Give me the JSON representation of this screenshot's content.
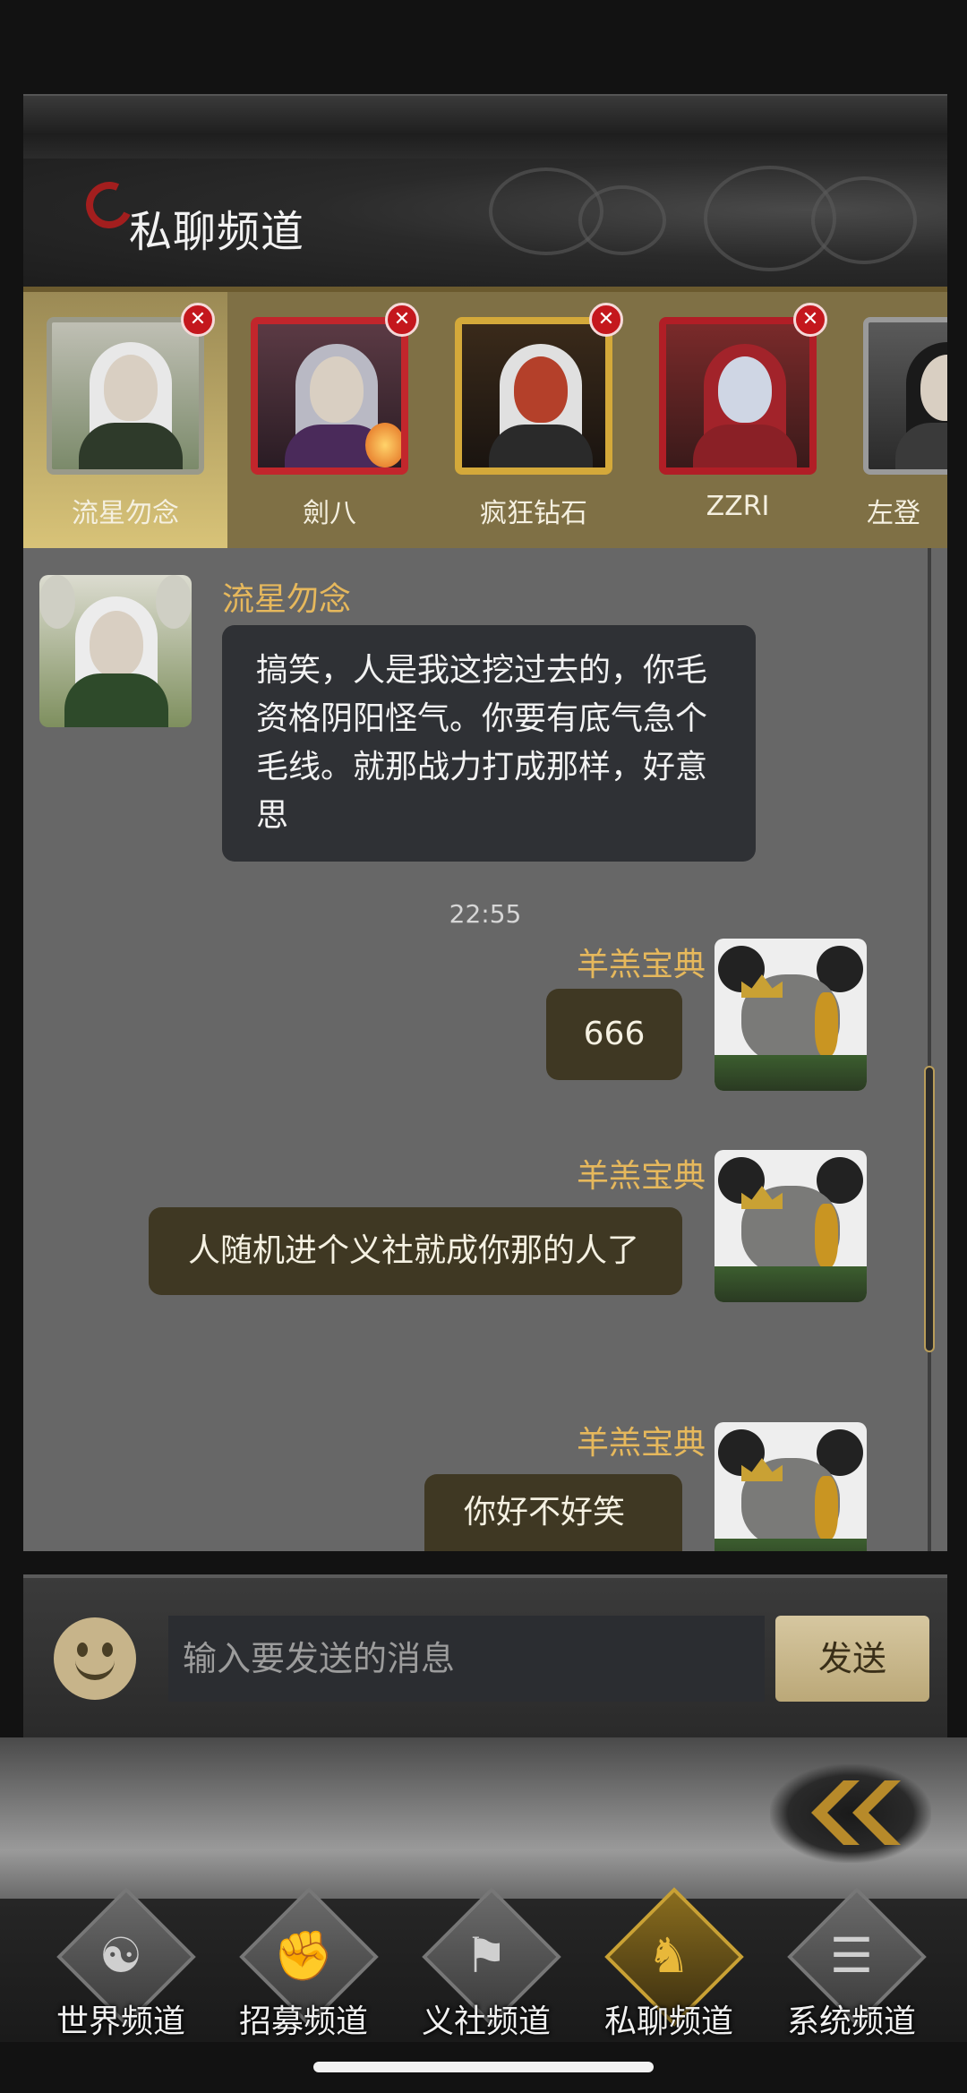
{
  "header": {
    "title": "私聊频道"
  },
  "contacts": [
    {
      "name": "流星勿念",
      "active": true,
      "frame": "#9a9a8a"
    },
    {
      "name": "劍八",
      "active": false,
      "frame": "#c2262c"
    },
    {
      "name": "疯狂钻石",
      "active": false,
      "frame": "#d4a93a"
    },
    {
      "name": "ZZRI",
      "active": false,
      "frame": "#b11e26"
    },
    {
      "name": "左登",
      "active": false,
      "frame": "#9a9a9a"
    }
  ],
  "chat": {
    "messages": [
      {
        "sender": "流星勿念",
        "text": "搞笑，人是我这挖过去的，你毛资格阴阳怪气。你要有底气急个毛线。就那战力打成那样，好意思",
        "direction": "incoming"
      },
      {
        "timestamp": "22:55"
      },
      {
        "sender": "羊羔宝典",
        "text": "666",
        "direction": "outgoing"
      },
      {
        "sender": "羊羔宝典",
        "text": "人随机进个义社就成你那的人了",
        "direction": "outgoing"
      },
      {
        "sender": "羊羔宝典",
        "text": "你好不好笑",
        "direction": "outgoing"
      }
    ]
  },
  "composer": {
    "placeholder": "输入要发送的消息",
    "send_label": "发送"
  },
  "tabs": [
    {
      "label": "世界频道",
      "icon": "world-swirl-icon",
      "glyph": "☯",
      "active": false
    },
    {
      "label": "招募频道",
      "icon": "handshake-icon",
      "glyph": "✊",
      "active": false
    },
    {
      "label": "义社频道",
      "icon": "banner-icon",
      "glyph": "⚑",
      "active": false
    },
    {
      "label": "私聊频道",
      "icon": "warrior-icon",
      "glyph": "♞",
      "active": true
    },
    {
      "label": "系统频道",
      "icon": "scroll-icon",
      "glyph": "☰",
      "active": false
    }
  ],
  "colors": {
    "accent_gold": "#e6b85c",
    "close_red": "#c4171d",
    "outgoing_bubble": "#3f3823",
    "incoming_bubble": "#2f3135"
  }
}
